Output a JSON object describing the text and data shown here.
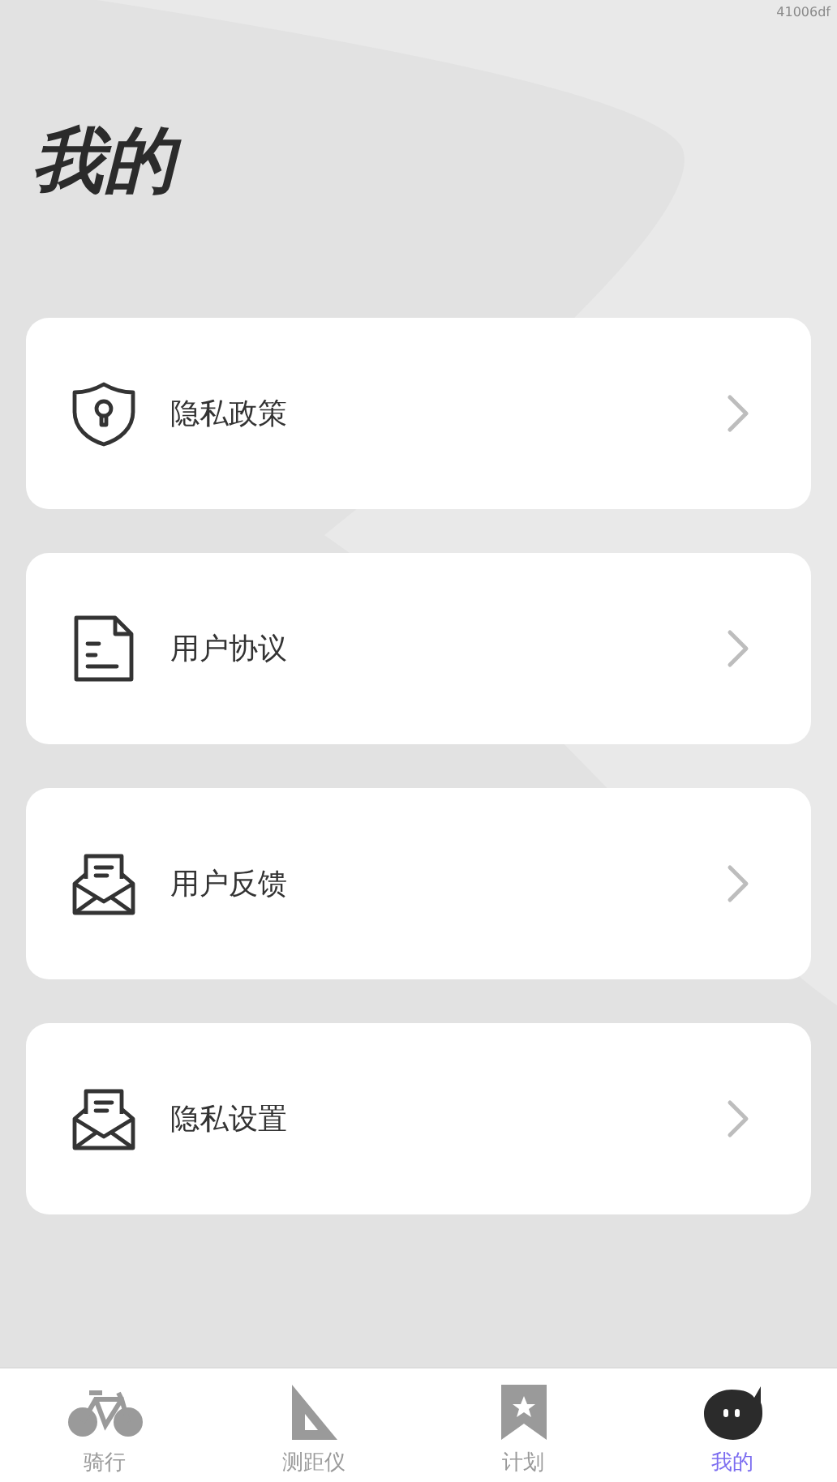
{
  "build_tag": "41006df",
  "title": "我的",
  "menu": [
    {
      "label": "隐私政策",
      "kind": "shield"
    },
    {
      "label": "用户协议",
      "kind": "document"
    },
    {
      "label": "用户反馈",
      "kind": "envelope"
    },
    {
      "label": "隐私设置",
      "kind": "envelope"
    }
  ],
  "tabs": [
    {
      "label": "骑行",
      "kind": "bike",
      "selected": false
    },
    {
      "label": "测距仪",
      "kind": "ruler",
      "selected": false
    },
    {
      "label": "计划",
      "kind": "bookmark",
      "selected": false
    },
    {
      "label": "我的",
      "kind": "face",
      "selected": true
    }
  ]
}
